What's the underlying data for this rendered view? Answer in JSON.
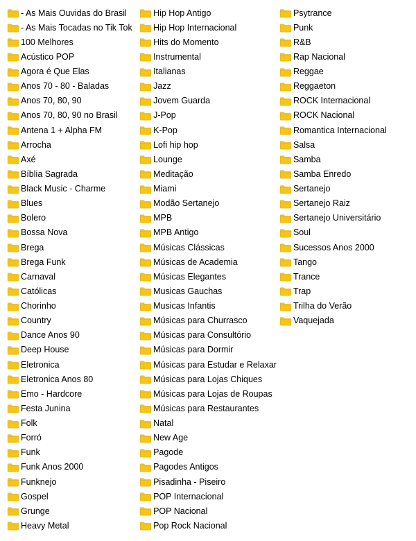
{
  "columns": [
    {
      "id": "col1",
      "items": [
        "- As Mais Ouvidas do Brasil",
        "- As Mais Tocadas no Tik Tok",
        "100 Melhores",
        "Acústico POP",
        "Agora é Que Elas",
        "Anos 70 - 80 - Baladas",
        "Anos 70, 80, 90",
        "Anos 70, 80, 90 no Brasil",
        "Antena 1 + Alpha FM",
        "Arrocha",
        "Axé",
        "Bíblia Sagrada",
        "Black Music - Charme",
        "Blues",
        "Bolero",
        "Bossa Nova",
        "Brega",
        "Brega Funk",
        "Carnaval",
        "Católicas",
        "Chorinho",
        "Country",
        "Dance Anos 90",
        "Deep House",
        "Eletronica",
        "Eletronica Anos 80",
        "Emo - Hardcore",
        "Festa Junina",
        "Folk",
        "Forró",
        "Funk",
        "Funk Anos 2000",
        "Funknejo",
        "Gospel",
        "Grunge",
        "Heavy Metal"
      ]
    },
    {
      "id": "col2",
      "items": [
        "Hip Hop Antigo",
        "Hip Hop Internacional",
        "Hits do Momento",
        "Instrumental",
        "Italianas",
        "Jazz",
        "Jovem Guarda",
        "J-Pop",
        "K-Pop",
        "Lofi hip hop",
        "Lounge",
        "Meditação",
        "Miami",
        "Modão Sertanejo",
        "MPB",
        "MPB Antigo",
        "Músicas Clássicas",
        "Músicas de Academia",
        "Músicas Elegantes",
        "Musicas Gauchas",
        "Musicas Infantis",
        "Músicas para Churrasco",
        "Músicas para Consultório",
        "Músicas para Dormir",
        "Músicas para Estudar e Relaxar",
        "Músicas para Lojas Chiques",
        "Músicas para Lojas de Roupas",
        "Músicas para Restaurantes",
        "Natal",
        "New Age",
        "Pagode",
        "Pagodes Antigos",
        "Pisadinha - Piseiro",
        "POP Internacional",
        "POP Nacional",
        "Pop Rock Nacional"
      ]
    },
    {
      "id": "col3",
      "items": [
        "Psytrance",
        "Punk",
        "R&B",
        "Rap Nacional",
        "Reggae",
        "Reggaeton",
        "ROCK Internacional",
        "ROCK Nacional",
        "Romantica Internacional",
        "Salsa",
        "Samba",
        "Samba Enredo",
        "Sertanejo",
        "Sertanejo Raiz",
        "Sertanejo Universitário",
        "Soul",
        "Sucessos Anos 2000",
        "Tango",
        "Trance",
        "Trap",
        "Trilha do Verão",
        "Vaquejada"
      ]
    }
  ],
  "folder_icon_color": "#f5c518",
  "folder_icon_dark": "#d4a000"
}
